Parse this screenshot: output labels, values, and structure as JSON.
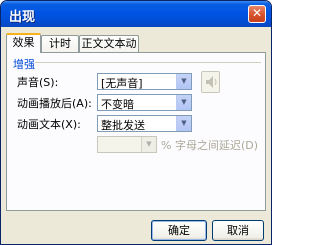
{
  "window": {
    "title": "出现",
    "close_glyph": "✕"
  },
  "tabs": [
    {
      "label": "效果",
      "active": true
    },
    {
      "label": "计时",
      "active": false
    },
    {
      "label": "正文文本动画",
      "active": false
    }
  ],
  "enhance": {
    "group_label": "增强",
    "sound": {
      "label": "声音(S):",
      "value": "[无声音]",
      "icon": "speaker-icon"
    },
    "after_animation": {
      "label": "动画播放后(A):",
      "value": "不变暗"
    },
    "animate_text": {
      "label": "动画文本(X):",
      "value": "整批发送"
    },
    "delay": {
      "value": "",
      "suffix": "% 字母之间延迟(D)"
    }
  },
  "buttons": {
    "ok": "确定",
    "cancel": "取消"
  },
  "colors": {
    "titlebar": "#0054e3",
    "accent_tab": "#f7b31c",
    "group_label": "#0046d5"
  }
}
